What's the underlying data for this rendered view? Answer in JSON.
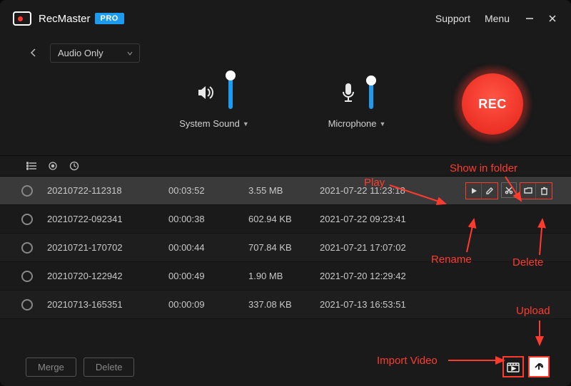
{
  "app": {
    "name": "RecMaster",
    "badge": "PRO"
  },
  "titlebar": {
    "support": "Support",
    "menu": "Menu"
  },
  "mode_select": {
    "value": "Audio Only"
  },
  "audio": {
    "system_label": "System Sound",
    "mic_label": "Microphone",
    "system_level_pct": 92,
    "mic_level_pct": 78
  },
  "rec_label": "REC",
  "recordings": [
    {
      "name": "20210722-112318",
      "duration": "00:03:52",
      "size": "3.55 MB",
      "date": "2021-07-22 11:23:18",
      "selected": true
    },
    {
      "name": "20210722-092341",
      "duration": "00:00:38",
      "size": "602.94 KB",
      "date": "2021-07-22 09:23:41",
      "selected": false
    },
    {
      "name": "20210721-170702",
      "duration": "00:00:44",
      "size": "707.84 KB",
      "date": "2021-07-21 17:07:02",
      "selected": false
    },
    {
      "name": "20210720-122942",
      "duration": "00:00:49",
      "size": "1.90 MB",
      "date": "2021-07-20 12:29:42",
      "selected": false
    },
    {
      "name": "20210713-165351",
      "duration": "00:00:09",
      "size": "337.08 KB",
      "date": "2021-07-13 16:53:51",
      "selected": false
    }
  ],
  "footer": {
    "merge": "Merge",
    "delete": "Delete"
  },
  "annotations": {
    "play": "Play",
    "rename": "Rename",
    "show_in_folder": "Show in folder",
    "delete": "Delete",
    "upload": "Upload",
    "import_video": "Import Video"
  },
  "accent_color": "#ff3b30"
}
